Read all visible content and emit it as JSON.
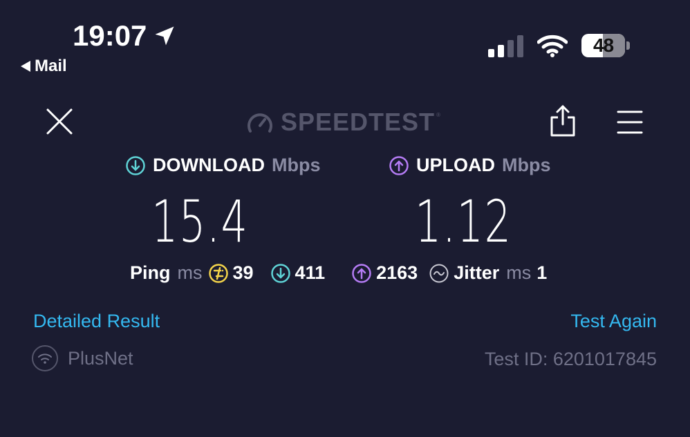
{
  "status_bar": {
    "time": "19:07",
    "back_app": "Mail",
    "battery": "48"
  },
  "header": {
    "brand": "SPEEDTEST",
    "brand_tm": "®"
  },
  "download": {
    "label": "DOWNLOAD",
    "unit": "Mbps",
    "value": "15.4",
    "color": "#5fd3d6"
  },
  "upload": {
    "label": "UPLOAD",
    "unit": "Mbps",
    "value": "1.12",
    "color": "#b57cf5"
  },
  "stats": {
    "ping_label": "Ping",
    "ping_unit": "ms",
    "ping_idle": "39",
    "ping_download": "411",
    "ping_upload": "2163",
    "jitter_label": "Jitter",
    "jitter_unit": "ms",
    "jitter": "1",
    "idle_color": "#f4d44a"
  },
  "links": {
    "detailed": "Detailed Result",
    "again": "Test Again",
    "color": "#34b8f0"
  },
  "footer": {
    "provider": "PlusNet",
    "test_id": "Test ID: 6201017845"
  },
  "icons": {
    "location": "location-arrow-icon",
    "back": "back-triangle-icon",
    "signal": "cellular-signal-icon",
    "wifi": "wifi-icon",
    "battery": "battery-icon",
    "close": "close-icon",
    "gauge": "gauge-icon",
    "share": "share-icon",
    "menu": "hamburger-menu-icon",
    "download": "download-arrow-icon",
    "upload": "upload-arrow-icon",
    "idle": "idle-ping-icon",
    "jitter": "jitter-wave-icon",
    "provider": "wifi-provider-icon"
  }
}
